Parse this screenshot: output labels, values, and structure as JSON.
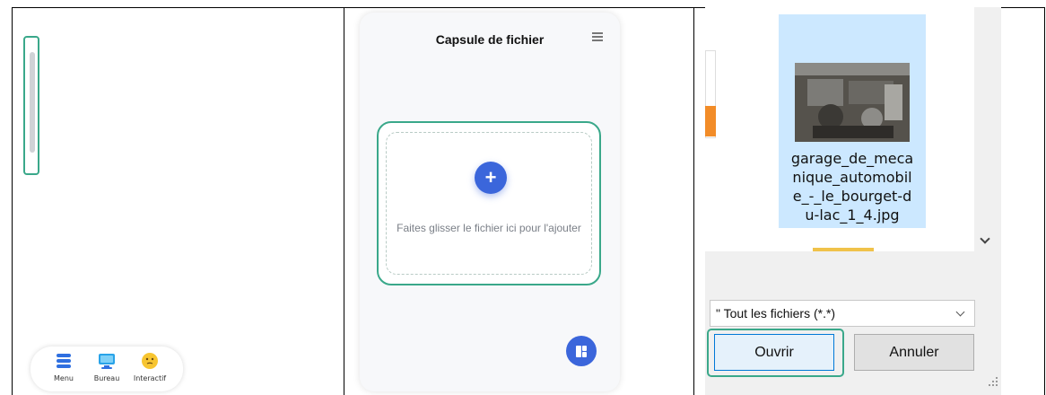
{
  "panel_launcher": {
    "taskbar": {
      "items": [
        {
          "label": "Menu",
          "icon": "menu-stack-icon"
        },
        {
          "label": "Bureau",
          "icon": "monitor-icon"
        },
        {
          "label": "Interactif",
          "icon": "thinking-face-icon"
        }
      ]
    }
  },
  "panel_capsule": {
    "title": "Capsule de fichier",
    "drop_zone": {
      "text": "Faites glisser le fichier ici pour l'ajouter",
      "plus_label": "+"
    }
  },
  "panel_file_dialog": {
    "selected_file": {
      "name": "garage_de_meca nique_automobil e_-_le_bourget-d u-lac_1_4.jpg",
      "name_lines": [
        "garage_de_meca",
        "nique_automobil",
        "e_-_le_bourget-d",
        "u-lac_1_4.jpg"
      ]
    },
    "filter": {
      "value": "\" Tout les fichiers (*.*)"
    },
    "open_label": "Ouvrir",
    "cancel_label": "Annuler"
  },
  "colors": {
    "accent_green": "#3aa88a",
    "primary_blue": "#3b66db",
    "selection_blue": "#cce8ff"
  }
}
